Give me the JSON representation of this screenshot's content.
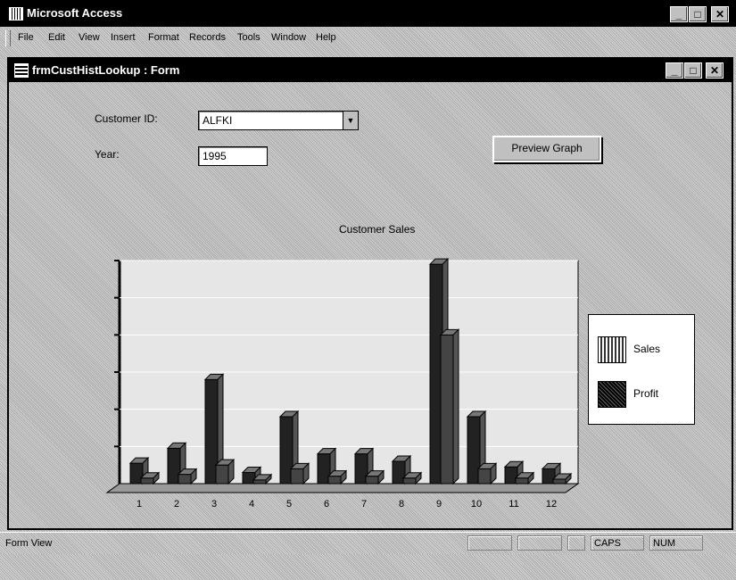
{
  "app": {
    "title": "Microsoft Access"
  },
  "window_buttons": {
    "minimize": "_",
    "maximize": "□",
    "close": "✕"
  },
  "menu": {
    "items": [
      "File",
      "Edit",
      "View",
      "Insert",
      "Format",
      "Records",
      "Tools",
      "Window",
      "Help"
    ]
  },
  "form": {
    "title": "frmCustHistLookup : Form",
    "customer_label": "Customer ID:",
    "customer_value": "ALFKI",
    "year_label": "Year:",
    "year_value": "1995",
    "preview_button": "Preview Graph"
  },
  "chart_data": {
    "type": "bar",
    "title": "Customer Sales",
    "categories": [
      "1",
      "2",
      "3",
      "4",
      "5",
      "6",
      "7",
      "8",
      "9",
      "10",
      "11",
      "12"
    ],
    "ylim": [
      0,
      6000
    ],
    "series": [
      {
        "name": "Sales",
        "values": [
          550,
          950,
          2800,
          300,
          1800,
          800,
          800,
          600,
          5900,
          1800,
          450,
          400
        ],
        "color": "#2a2a2a"
      },
      {
        "name": "Profit",
        "values": [
          150,
          250,
          500,
          100,
          400,
          200,
          200,
          150,
          4000,
          400,
          150,
          120
        ],
        "color": "#3a3a3a"
      }
    ]
  },
  "statusbar": {
    "text": "Form View",
    "panels": [
      "",
      "",
      "",
      "CAPS",
      "NUM"
    ]
  }
}
